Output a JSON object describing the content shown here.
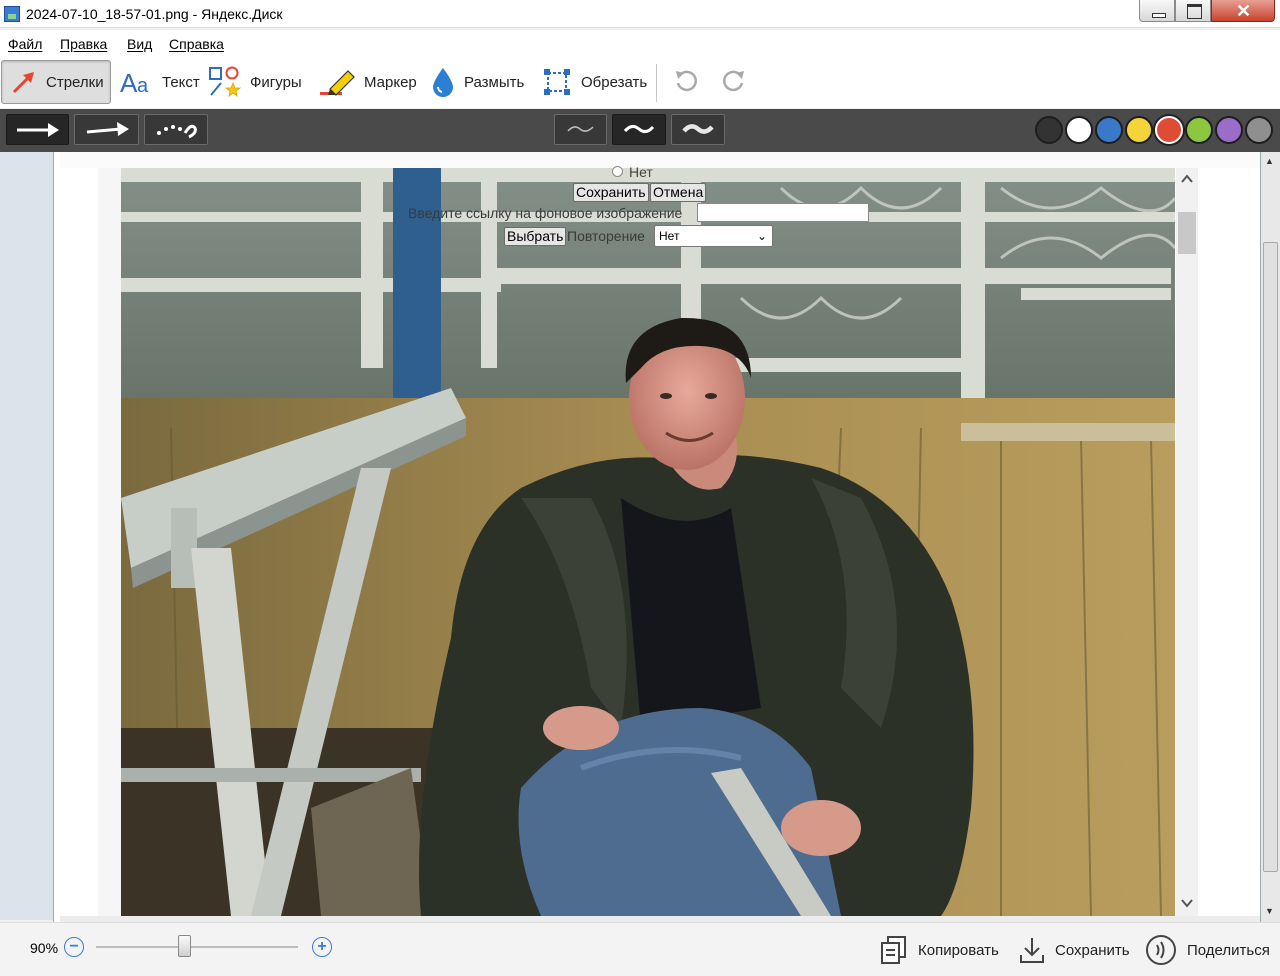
{
  "window": {
    "title": "2024-07-10_18-57-01.png - Яндекс.Диск"
  },
  "menu": {
    "items": [
      "Файл",
      "Правка",
      "Вид",
      "Справка"
    ]
  },
  "toolbar": {
    "tools": [
      {
        "label": "Стрелки",
        "icon": "arrow-icon",
        "active": true
      },
      {
        "label": "Текст",
        "icon": "text-icon"
      },
      {
        "label": "Фигуры",
        "icon": "shapes-icon"
      },
      {
        "label": "Маркер",
        "icon": "marker-icon"
      },
      {
        "label": "Размыть",
        "icon": "blur-drop-icon"
      },
      {
        "label": "Обрезать",
        "icon": "crop-icon"
      }
    ],
    "undo_icon": "undo-icon",
    "redo_icon": "redo-icon"
  },
  "options": {
    "arrow_styles": [
      "arrow-thick",
      "arrow-thin",
      "arrow-dotted"
    ],
    "stroke_widths": [
      "thin",
      "medium",
      "thick"
    ],
    "selected_stroke": "medium",
    "colors": [
      "#333333",
      "#ffffff",
      "#3a78c9",
      "#f3d53a",
      "#e04b36",
      "#8dc63f",
      "#9b6cc9",
      "#8f8f8f"
    ],
    "selected_color": "#e04b36"
  },
  "web_form": {
    "radio_label": "Нет",
    "save_button": "Сохранить",
    "cancel_button": "Отмена",
    "bg_link_label": "Введите ссылку на фоновое изображение",
    "choose_button": "Выбрать",
    "repeat_label": "Повторение",
    "repeat_value": "Нет"
  },
  "bottom": {
    "zoom": "90%",
    "zoom_fraction": 0.44,
    "copy_label": "Копировать",
    "save_label": "Сохранить",
    "share_label": "Поделиться"
  }
}
